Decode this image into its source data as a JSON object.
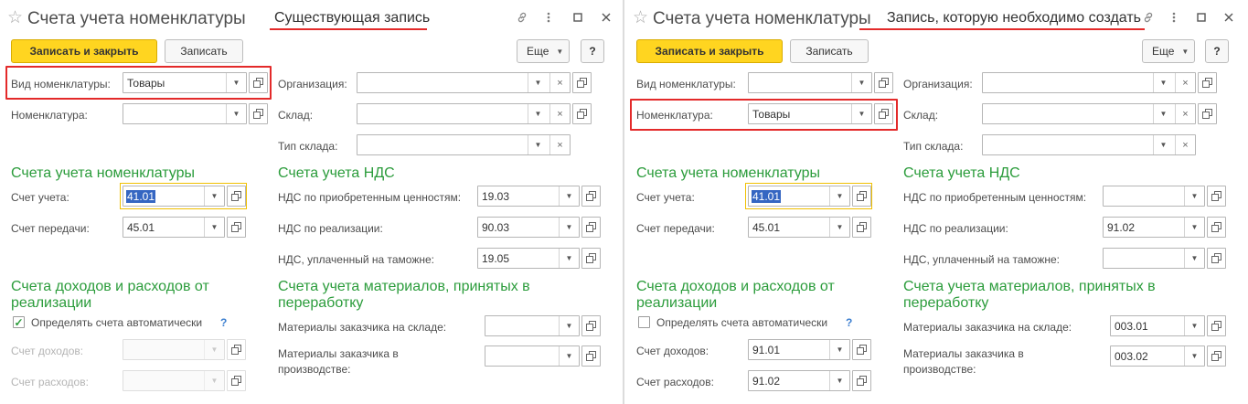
{
  "panels": [
    {
      "title": "Счета учета номенклатуры",
      "note": "Существующая запись",
      "icons": {
        "star": "star-icon",
        "link": "link-icon",
        "more": "more-vert-icon",
        "maximize": "maximize-icon",
        "close": "close-icon"
      },
      "toolbar": {
        "save_close": "Записать и закрыть",
        "save": "Записать",
        "more": "Еще",
        "help": "?"
      },
      "fields": {
        "vid": {
          "label": "Вид номенклатуры:",
          "value": "Товары"
        },
        "nom": {
          "label": "Номенклатура:",
          "value": ""
        },
        "org": {
          "label": "Организация:",
          "value": ""
        },
        "sklad": {
          "label": "Склад:",
          "value": ""
        },
        "tip": {
          "label": "Тип склада:",
          "value": ""
        },
        "sch_uch": {
          "label": "Счет учета:",
          "value": "41.01"
        },
        "sch_per": {
          "label": "Счет передачи:",
          "value": "45.01"
        },
        "nds_priob": {
          "label": "НДС по приобретенным ценностям:",
          "value": "19.03"
        },
        "nds_real": {
          "label": "НДС по реализации:",
          "value": "90.03"
        },
        "nds_tam": {
          "label": "НДС, уплаченный на таможне:",
          "value": "19.05"
        },
        "dohod": {
          "label": "Счет доходов:",
          "value": ""
        },
        "rashod": {
          "label": "Счет расходов:",
          "value": ""
        },
        "mat_sklad": {
          "label": "Материалы заказчика на складе:",
          "value": ""
        },
        "mat_pr1": {
          "label": "Материалы заказчика в",
          "value": ""
        },
        "mat_pr2": {
          "label": "производстве:"
        }
      },
      "sections": {
        "nom": "Счета учета номенклатуры",
        "nds": "Счета учета НДС",
        "doh1": "Счета доходов и расходов от",
        "doh2": "реализации",
        "mat1": "Счета учета материалов, принятых в",
        "mat2": "переработку"
      },
      "auto": {
        "label": "Определять счета автоматически",
        "checked": true,
        "help": "?"
      }
    },
    {
      "title": "Счета учета номенклатуры",
      "note": "Запись, которую необходимо создать",
      "icons": {
        "star": "star-icon",
        "link": "link-icon",
        "more": "more-vert-icon",
        "maximize": "maximize-icon",
        "close": "close-icon"
      },
      "toolbar": {
        "save_close": "Записать и закрыть",
        "save": "Записать",
        "more": "Еще",
        "help": "?"
      },
      "fields": {
        "vid": {
          "label": "Вид номенклатуры:",
          "value": ""
        },
        "nom": {
          "label": "Номенклатура:",
          "value": "Товары"
        },
        "org": {
          "label": "Организация:",
          "value": ""
        },
        "sklad": {
          "label": "Склад:",
          "value": ""
        },
        "tip": {
          "label": "Тип склада:",
          "value": ""
        },
        "sch_uch": {
          "label": "Счет учета:",
          "value": "41.01"
        },
        "sch_per": {
          "label": "Счет передачи:",
          "value": "45.01"
        },
        "nds_priob": {
          "label": "НДС по приобретенным ценностям:",
          "value": ""
        },
        "nds_real": {
          "label": "НДС по реализации:",
          "value": "91.02"
        },
        "nds_tam": {
          "label": "НДС, уплаченный на таможне:",
          "value": ""
        },
        "dohod": {
          "label": "Счет доходов:",
          "value": "91.01"
        },
        "rashod": {
          "label": "Счет расходов:",
          "value": "91.02"
        },
        "mat_sklad": {
          "label": "Материалы заказчика на складе:",
          "value": "003.01"
        },
        "mat_pr1": {
          "label": "Материалы заказчика в",
          "value": "003.02"
        },
        "mat_pr2": {
          "label": "производстве:"
        }
      },
      "sections": {
        "nom": "Счета учета номенклатуры",
        "nds": "Счета учета НДС",
        "doh1": "Счета доходов и расходов от",
        "doh2": "реализации",
        "mat1": "Счета учета материалов, принятых в",
        "mat2": "переработку"
      },
      "auto": {
        "label": "Определять счета автоматически",
        "checked": false,
        "help": "?"
      }
    }
  ],
  "colors": {
    "accent_green": "#2b9c3b",
    "highlight_red": "#e32a2a",
    "primary_yellow": "#ffd520",
    "focus_yellow": "#f0c000"
  }
}
